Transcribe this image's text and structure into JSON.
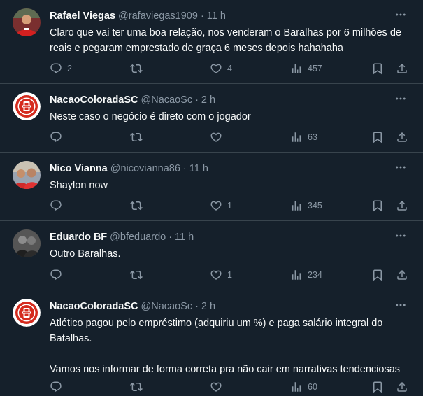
{
  "colors": {
    "background": "#15202b",
    "divider": "#38444d",
    "text": "#f7f9f9",
    "muted": "#8b98a5"
  },
  "tweets": [
    {
      "name": "Rafael Viegas",
      "handle": "@rafaviegas1909",
      "separator": "·",
      "time": "11 h",
      "text": "Claro que vai ter uma boa relação, nos venderam o Baralhas por 6 milhões de reais e pegaram emprestado de graça 6 meses depois hahahaha",
      "replies": "2",
      "retweets": "",
      "likes": "4",
      "views": "457",
      "avatar": "photo-red-shirt"
    },
    {
      "name": "NacaoColoradaSC",
      "handle": "@NacaoSc",
      "separator": "·",
      "time": "2 h",
      "text": "Neste caso o negócio é direto com o jogador",
      "replies": "",
      "retweets": "",
      "likes": "",
      "views": "63",
      "avatar": "internacional-crest"
    },
    {
      "name": "Nico Vianna",
      "handle": "@nicovianna86",
      "separator": "·",
      "time": "11 h",
      "text": "Shaylon now",
      "replies": "",
      "retweets": "",
      "likes": "1",
      "views": "345",
      "avatar": "photo-group"
    },
    {
      "name": "Eduardo BF",
      "handle": "@bfeduardo",
      "separator": "·",
      "time": "11 h",
      "text": "Outro Baralhas.",
      "replies": "",
      "retweets": "",
      "likes": "1",
      "views": "234",
      "avatar": "photo-monochrome"
    },
    {
      "name": "NacaoColoradaSC",
      "handle": "@NacaoSc",
      "separator": "·",
      "time": "2 h",
      "text": "Atlético pagou pelo empréstimo (adquiriu um %) e paga salário integral do Batalhas.\n\nVamos nos informar de forma correta pra não cair em narrativas tendenciosas",
      "replies": "",
      "retweets": "",
      "likes": "",
      "views": "60",
      "avatar": "internacional-crest"
    }
  ]
}
